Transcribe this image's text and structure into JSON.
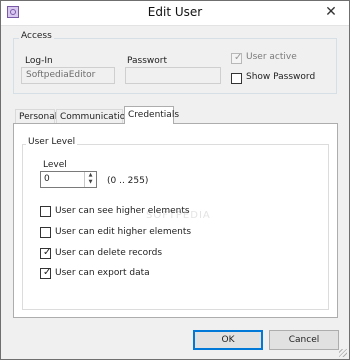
{
  "window": {
    "title": "Edit User",
    "close_glyph": "✕",
    "app_icon": "user-edit-icon"
  },
  "access": {
    "group_title": "Access",
    "login_label": "Log-In",
    "login_value": "SoftpediaEditor",
    "password_label": "Passwort",
    "password_value": "",
    "user_active_label": "User active",
    "user_active_checked": true,
    "show_password_label": "Show Password",
    "show_password_checked": false
  },
  "tabs": [
    {
      "label": "Personal",
      "active": false
    },
    {
      "label": "Communication",
      "active": false
    },
    {
      "label": "Credentials",
      "active": true
    }
  ],
  "credentials": {
    "group_title": "User Level",
    "level_label": "Level",
    "level_value": "0",
    "range_hint": "(0 .. 255)",
    "watermark": "SOFTPEDIA",
    "permissions": [
      {
        "label": "User can see higher elements",
        "checked": false
      },
      {
        "label": "User can edit higher elements",
        "checked": false
      },
      {
        "label": "User can delete records",
        "checked": true
      },
      {
        "label": "User can export data",
        "checked": true
      }
    ]
  },
  "buttons": {
    "ok": "OK",
    "cancel": "Cancel"
  },
  "colors": {
    "accent": "#0078d7",
    "window_bg": "#f0f0f0"
  }
}
